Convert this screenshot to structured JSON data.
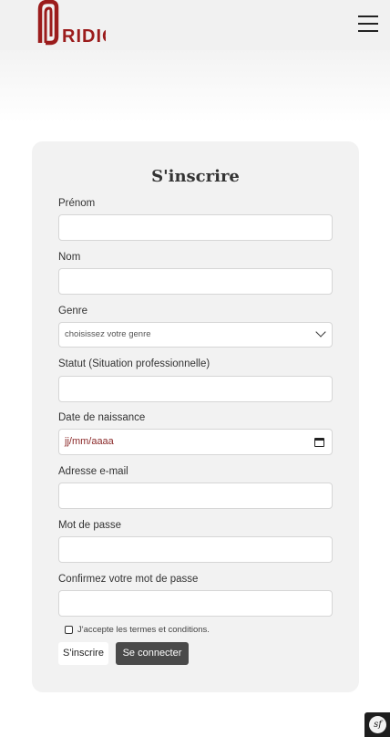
{
  "header": {
    "logo_text": "RIDIQ",
    "menu_icon": "hamburger-menu-icon",
    "brand_color": "#9b1c1c"
  },
  "form": {
    "title": "S'inscrire",
    "fields": {
      "first_name": {
        "label": "Prénom",
        "value": ""
      },
      "last_name": {
        "label": "Nom",
        "value": ""
      },
      "gender": {
        "label": "Genre",
        "selected": "choisissez votre genre"
      },
      "status": {
        "label": "Statut (Situation professionnelle)",
        "value": ""
      },
      "birth_date": {
        "label": "Date de naissance",
        "placeholder": "jj/mm/aaaa"
      },
      "email": {
        "label": "Adresse e-mail",
        "value": ""
      },
      "password": {
        "label": "Mot de passe",
        "value": ""
      },
      "password_confirm": {
        "label": "Confirmez votre mot de passe",
        "value": ""
      }
    },
    "terms_label": "J'accepte les termes et conditions.",
    "terms_checked": false,
    "signup_label": "S'inscrire",
    "login_label": "Se connecter"
  },
  "debug_toolbar": {
    "icon": "symfony-icon",
    "glyph": "sf"
  }
}
